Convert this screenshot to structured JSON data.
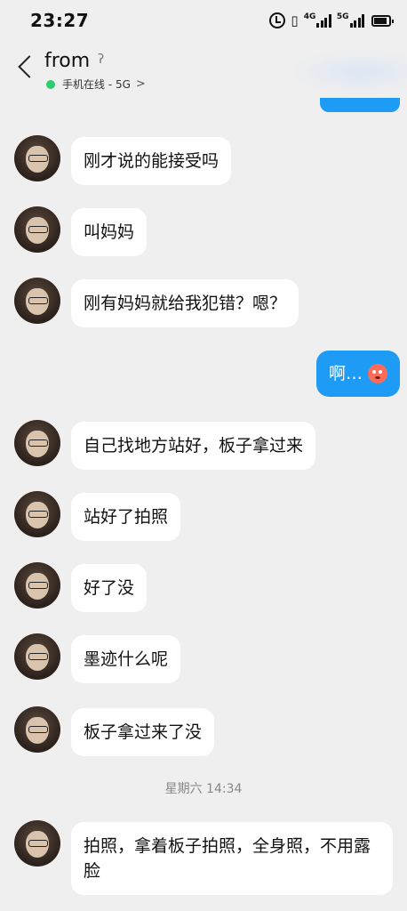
{
  "status_bar": {
    "time": "23:27",
    "net1": "4G",
    "net2": "5G"
  },
  "header": {
    "contact_name": "from",
    "online_status": "手机在线 - 5G",
    "ear_icon": "ear-icon",
    "online_color": "#2ecc71"
  },
  "colors": {
    "outgoing_bubble": "#1e9bf5",
    "incoming_bubble": "#ffffff",
    "background": "#efefef"
  },
  "messages": [
    {
      "direction": "in",
      "text": "刚才说的能接受吗"
    },
    {
      "direction": "in",
      "text": "叫妈妈"
    },
    {
      "direction": "in",
      "text": "刚有妈妈就给我犯错？嗯？"
    },
    {
      "direction": "out",
      "text": "啊…"
    },
    {
      "direction": "in",
      "text": "自己找地方站好，板子拿过来"
    },
    {
      "direction": "in",
      "text": "站好了拍照"
    },
    {
      "direction": "in",
      "text": "好了没"
    },
    {
      "direction": "in",
      "text": "墨迹什么呢"
    },
    {
      "direction": "in",
      "text": "板子拿过来了没"
    },
    {
      "direction": "in",
      "text": "拍照，拿着板子拍照，全身照，不用露脸"
    }
  ],
  "timestamp": "星期六 14:34"
}
